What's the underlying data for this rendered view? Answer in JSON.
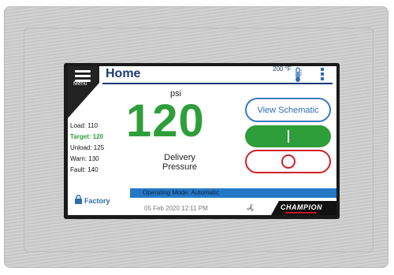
{
  "header": {
    "menu_label": "Menu",
    "title": "Home",
    "temperature": "200 °F"
  },
  "pressure": {
    "unit": "psi",
    "value": "120",
    "label_line1": "Delivery",
    "label_line2": "Pressure"
  },
  "parameters": [
    {
      "label": "Load: 110"
    },
    {
      "label": "Target: 120"
    },
    {
      "label": "Unload: 125"
    },
    {
      "label": "Warn: 130"
    },
    {
      "label": "Fault: 140"
    }
  ],
  "buttons": {
    "view_schematic": "View Schematic"
  },
  "footer": {
    "operating_mode": "Operating Mode: Automatic",
    "access_level": "Factory",
    "datetime": "05 Feb 2020  12:11 PM",
    "brand": "CHAMPION"
  },
  "colors": {
    "title_blue": "#1c3a78",
    "pressure_green": "#2e9e3a",
    "stop_red": "#d12028",
    "mode_bar_blue": "#2479c7"
  },
  "icons": [
    "menu-icon",
    "thermometer-icon",
    "status-indicator-icon",
    "lock-icon",
    "fan-icon"
  ]
}
